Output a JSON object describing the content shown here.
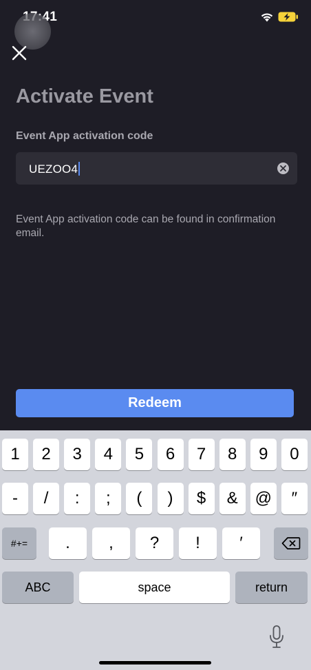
{
  "status_bar": {
    "time": "17:41",
    "wifi_icon": "wifi-icon",
    "battery_icon": "battery-charging-icon",
    "battery_color": "#f5d23a"
  },
  "header": {
    "close_icon": "close-icon",
    "title": "Activate Event"
  },
  "form": {
    "label": "Event App activation code",
    "code_value": "UEZOO4",
    "clear_icon": "clear-icon",
    "helper_text": "Event App activation code can be found in confirmation email."
  },
  "redeem_button": {
    "label": "Redeem",
    "color": "#5a8bf0"
  },
  "keyboard": {
    "row1": [
      "1",
      "2",
      "3",
      "4",
      "5",
      "6",
      "7",
      "8",
      "9",
      "0"
    ],
    "row2": [
      "-",
      "/",
      ":",
      ";",
      "(",
      ")",
      "$",
      "&",
      "@",
      "″"
    ],
    "row3_mode": "#+=",
    "row3": [
      ".",
      ",",
      "?",
      "!",
      "′"
    ],
    "backspace_icon": "backspace-icon",
    "abc_label": "ABC",
    "space_label": "space",
    "return_label": "return",
    "mic_icon": "microphone-icon"
  }
}
